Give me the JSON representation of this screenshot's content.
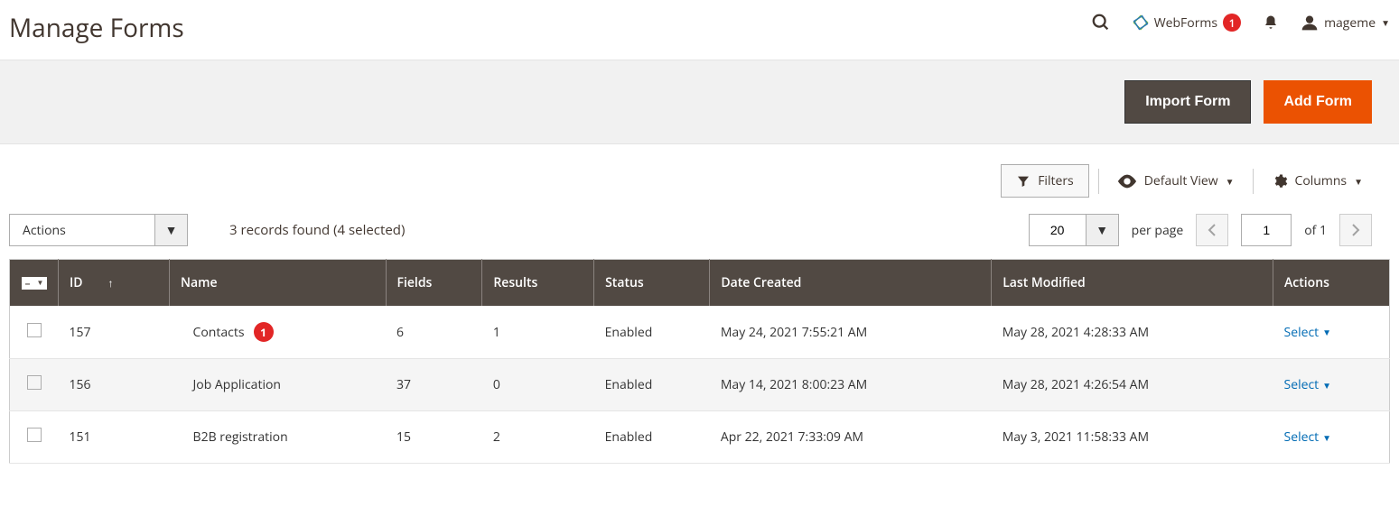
{
  "header": {
    "title": "Manage Forms",
    "webforms_label": "WebForms",
    "webforms_badge": "1",
    "username": "mageme"
  },
  "toolbar": {
    "import_label": "Import Form",
    "add_label": "Add Form"
  },
  "controls": {
    "filters_label": "Filters",
    "default_view_label": "Default View",
    "columns_label": "Columns"
  },
  "mid": {
    "actions_label": "Actions",
    "records_found": "3 records found (4 selected)",
    "page_size": "20",
    "per_page_label": "per page",
    "current_page": "1",
    "of_label": "of 1"
  },
  "table": {
    "headers": {
      "id": "ID",
      "name": "Name",
      "fields": "Fields",
      "results": "Results",
      "status": "Status",
      "date_created": "Date Created",
      "last_modified": "Last Modified",
      "actions": "Actions"
    },
    "rows": [
      {
        "id": "157",
        "name": "Contacts",
        "badge": "1",
        "fields": "6",
        "results": "1",
        "status": "Enabled",
        "created": "May 24, 2021 7:55:21 AM",
        "modified": "May 28, 2021 4:28:33 AM",
        "action": "Select"
      },
      {
        "id": "156",
        "name": "Job Application",
        "badge": "",
        "fields": "37",
        "results": "0",
        "status": "Enabled",
        "created": "May 14, 2021 8:00:23 AM",
        "modified": "May 28, 2021 4:26:54 AM",
        "action": "Select"
      },
      {
        "id": "151",
        "name": "B2B registration",
        "badge": "",
        "fields": "15",
        "results": "2",
        "status": "Enabled",
        "created": "Apr 22, 2021 7:33:09 AM",
        "modified": "May 3, 2021 11:58:33 AM",
        "action": "Select"
      }
    ]
  }
}
